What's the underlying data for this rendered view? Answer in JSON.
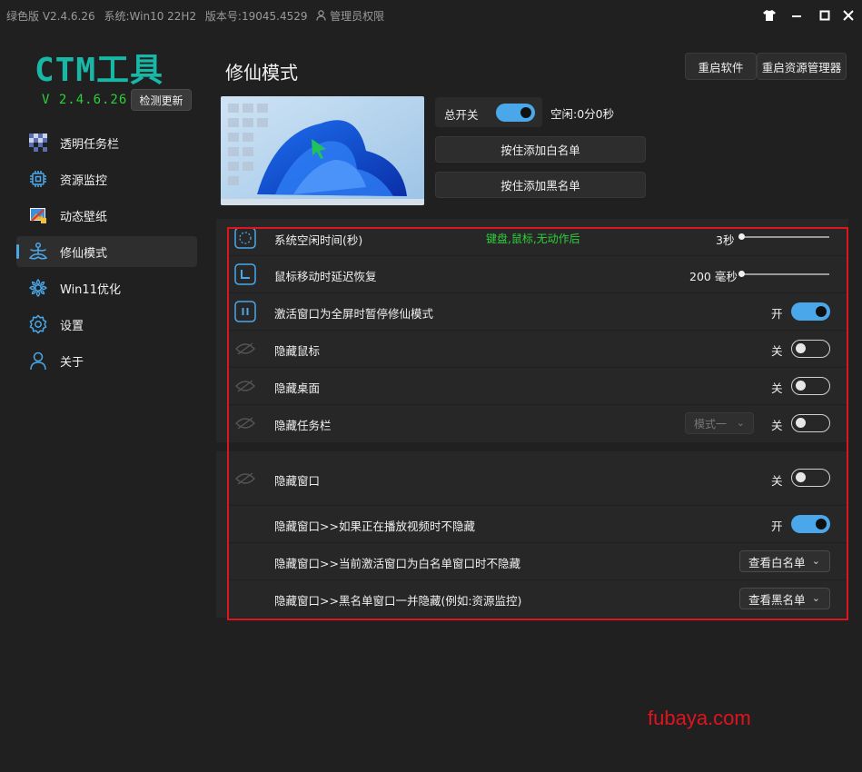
{
  "titlebar": {
    "edition": "绿色版 V2.4.6.26",
    "system": "系统:Win10 22H2",
    "build": "版本号:19045.4529",
    "admin": "管理员权限"
  },
  "brand": {
    "name": "CTM工具",
    "version": "V 2.4.6.26",
    "update_button": "检测更新",
    "colors": {
      "name": "#19b7a6",
      "version": "#2ecf3a"
    }
  },
  "sidebar": {
    "items": [
      {
        "label": "透明任务栏",
        "icon": "checker-icon"
      },
      {
        "label": "资源监控",
        "icon": "chip-icon"
      },
      {
        "label": "动态壁纸",
        "icon": "wallpaper-icon"
      },
      {
        "label": "修仙模式",
        "icon": "meditation-icon",
        "active": true
      },
      {
        "label": "Win11优化",
        "icon": "gear-flower-icon"
      },
      {
        "label": "设置",
        "icon": "settings-icon"
      },
      {
        "label": "关于",
        "icon": "user-icon"
      }
    ]
  },
  "main": {
    "title": "修仙模式",
    "restart_software": "重启软件",
    "restart_explorer": "重启资源管理器",
    "master_switch_label": "总开关",
    "master_switch_on": true,
    "idle_status": "空闲:0分0秒",
    "add_whitelist": "按住添加白名单",
    "add_blacklist": "按住添加黑名单"
  },
  "settings": {
    "idle_time": {
      "label": "系统空闲时间(秒)",
      "hint": "键盘,鼠标,无动作后",
      "value": "3秒",
      "level": 0.0
    },
    "mouse_delay": {
      "label": "鼠标移动时延迟恢复",
      "value": "200 毫秒",
      "level": 0.0
    },
    "fullscreen_pause": {
      "label": "激活窗口为全屏时暂停修仙模式",
      "state": "开",
      "on": true
    },
    "hide_cursor": {
      "label": "隐藏鼠标",
      "state": "关",
      "on": false
    },
    "hide_desktop": {
      "label": "隐藏桌面",
      "state": "关",
      "on": false
    },
    "hide_taskbar": {
      "label": "隐藏任务栏",
      "state": "关",
      "on": false,
      "mode": "模式一"
    },
    "hide_window": {
      "label": "隐藏窗口",
      "state": "关",
      "on": false
    },
    "video_exempt": {
      "label": "隐藏窗口>>如果正在播放视频时不隐藏",
      "state": "开",
      "on": true
    },
    "whitelist_exempt": {
      "label": "隐藏窗口>>当前激活窗口为白名单窗口时不隐藏",
      "button": "查看白名单"
    },
    "blacklist_hide": {
      "label": "隐藏窗口>>黑名单窗口一并隐藏(例如:资源监控)",
      "button": "查看黑名单"
    }
  },
  "watermark": "fubaya.com",
  "colors": {
    "accent": "#4aa8ea",
    "highlight_box": "#e0141e",
    "hint": "#2ecf3a"
  }
}
